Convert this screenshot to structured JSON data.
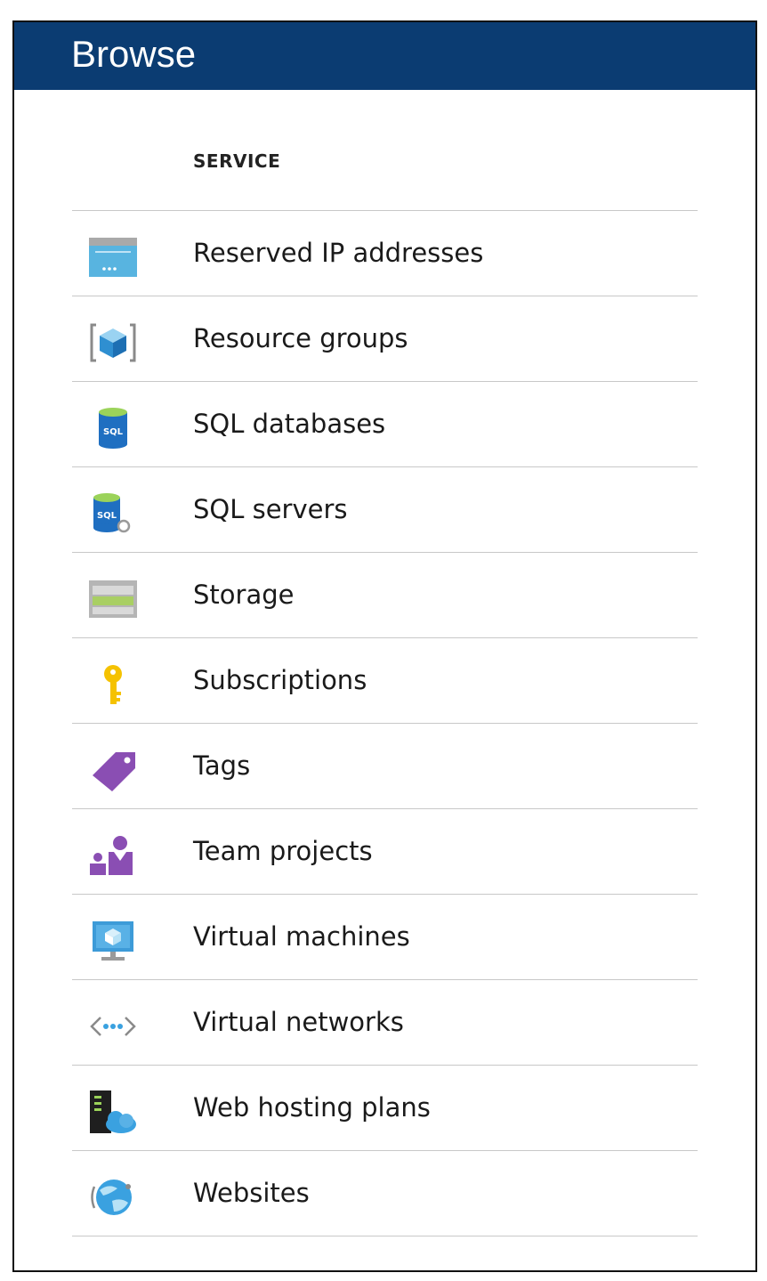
{
  "blade": {
    "title": "Browse",
    "header_color": "#0b3c72"
  },
  "table": {
    "column_header": "SERVICE"
  },
  "services": [
    {
      "label": "Reserved IP addresses",
      "icon": "reserved-ip-icon"
    },
    {
      "label": "Resource groups",
      "icon": "resource-group-icon"
    },
    {
      "label": "SQL databases",
      "icon": "sql-database-icon"
    },
    {
      "label": "SQL servers",
      "icon": "sql-server-icon"
    },
    {
      "label": "Storage",
      "icon": "storage-icon"
    },
    {
      "label": "Subscriptions",
      "icon": "key-icon"
    },
    {
      "label": "Tags",
      "icon": "tag-icon"
    },
    {
      "label": "Team projects",
      "icon": "team-icon"
    },
    {
      "label": "Virtual machines",
      "icon": "virtual-machine-icon"
    },
    {
      "label": "Virtual networks",
      "icon": "virtual-network-icon"
    },
    {
      "label": "Web hosting plans",
      "icon": "web-hosting-plan-icon"
    },
    {
      "label": "Websites",
      "icon": "website-globe-icon"
    }
  ]
}
